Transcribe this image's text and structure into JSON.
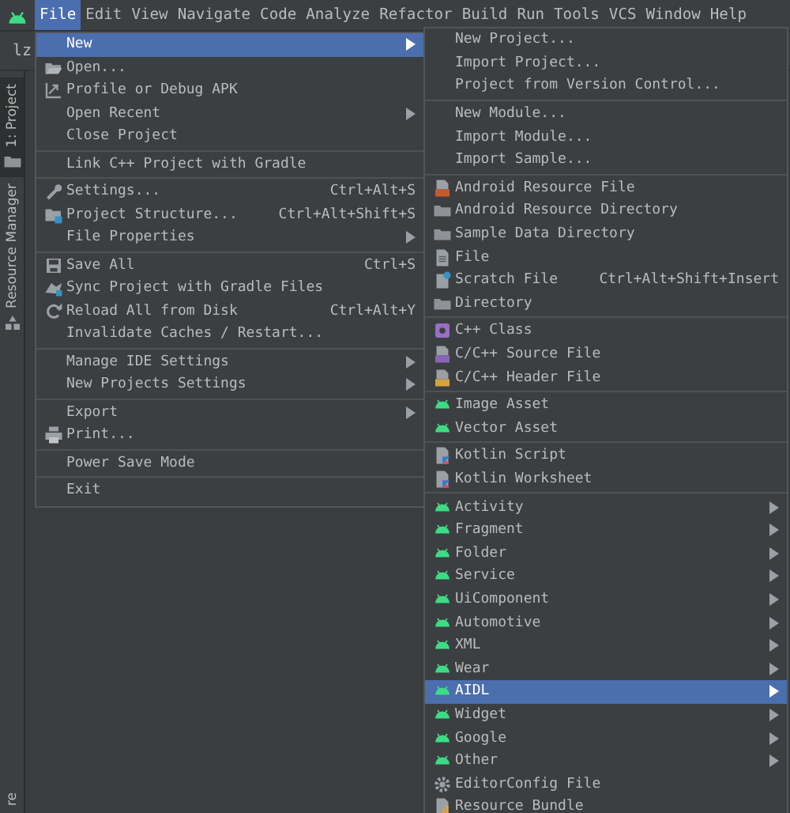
{
  "menu_bar": [
    {
      "label": "File",
      "selected": true
    },
    {
      "label": "Edit",
      "selected": false
    },
    {
      "label": "View",
      "selected": false
    },
    {
      "label": "Navigate",
      "selected": false
    },
    {
      "label": "Code",
      "selected": false
    },
    {
      "label": "Analyze",
      "selected": false
    },
    {
      "label": "Refactor",
      "selected": false
    },
    {
      "label": "Build",
      "selected": false
    },
    {
      "label": "Run",
      "selected": false
    },
    {
      "label": "Tools",
      "selected": false
    },
    {
      "label": "VCS",
      "selected": false
    },
    {
      "label": "Window",
      "selected": false
    },
    {
      "label": "Help",
      "selected": false
    }
  ],
  "toolbar": {
    "project_name": "lz"
  },
  "side_tabs": [
    {
      "label": "1: Project",
      "selected": true,
      "kind": "folder"
    },
    {
      "label": "Resource Manager",
      "selected": false,
      "kind": "resource"
    }
  ],
  "side_tab_bottom": "re",
  "file_menu": [
    [
      {
        "label": "New",
        "selected": true,
        "submenu": true,
        "kind": "none"
      },
      {
        "label": "Open...",
        "selected": false,
        "kind": "open"
      },
      {
        "label": "Profile or Debug APK",
        "selected": false,
        "kind": "profile"
      },
      {
        "label": "Open Recent",
        "selected": false,
        "submenu": true,
        "kind": "none"
      },
      {
        "label": "Close Project",
        "selected": false,
        "kind": "none"
      }
    ],
    [
      {
        "label": "Link C++ Project with Gradle",
        "selected": false,
        "kind": "none"
      }
    ],
    [
      {
        "label": "Settings...",
        "selected": false,
        "shortcut": "Ctrl+Alt+S",
        "kind": "wrench"
      },
      {
        "label": "Project Structure...",
        "selected": false,
        "shortcut": "Ctrl+Alt+Shift+S",
        "kind": "structure"
      },
      {
        "label": "File Properties",
        "selected": false,
        "submenu": true,
        "kind": "none"
      }
    ],
    [
      {
        "label": "Save All",
        "selected": false,
        "shortcut": "Ctrl+S",
        "kind": "save"
      },
      {
        "label": "Sync Project with Gradle Files",
        "selected": false,
        "kind": "sync"
      },
      {
        "label": "Reload All from Disk",
        "selected": false,
        "shortcut": "Ctrl+Alt+Y",
        "kind": "reload"
      },
      {
        "label": "Invalidate Caches / Restart...",
        "selected": false,
        "kind": "none"
      }
    ],
    [
      {
        "label": "Manage IDE Settings",
        "selected": false,
        "submenu": true,
        "kind": "none"
      },
      {
        "label": "New Projects Settings",
        "selected": false,
        "submenu": true,
        "kind": "none"
      }
    ],
    [
      {
        "label": "Export",
        "selected": false,
        "submenu": true,
        "kind": "none"
      },
      {
        "label": "Print...",
        "selected": false,
        "kind": "print"
      }
    ],
    [
      {
        "label": "Power Save Mode",
        "selected": false,
        "kind": "none"
      }
    ],
    [
      {
        "label": "Exit",
        "selected": false,
        "kind": "none"
      }
    ]
  ],
  "new_menu": [
    [
      {
        "label": "New Project...",
        "selected": false,
        "kind": "none"
      },
      {
        "label": "Import Project...",
        "selected": false,
        "kind": "none"
      },
      {
        "label": "Project from Version Control...",
        "selected": false,
        "kind": "none"
      }
    ],
    [
      {
        "label": "New Module...",
        "selected": false,
        "kind": "none"
      },
      {
        "label": "Import Module...",
        "selected": false,
        "kind": "none"
      },
      {
        "label": "Import Sample...",
        "selected": false,
        "kind": "none"
      }
    ],
    [
      {
        "label": "Android Resource File",
        "selected": false,
        "kind": "resfile"
      },
      {
        "label": "Android Resource Directory",
        "selected": false,
        "kind": "folder"
      },
      {
        "label": "Sample Data Directory",
        "selected": false,
        "kind": "folder"
      },
      {
        "label": "File",
        "selected": false,
        "kind": "file"
      },
      {
        "label": "Scratch File",
        "selected": false,
        "shortcut": "Ctrl+Alt+Shift+Insert",
        "kind": "scratch"
      },
      {
        "label": "Directory",
        "selected": false,
        "kind": "folder"
      }
    ],
    [
      {
        "label": "C++ Class",
        "selected": false,
        "kind": "cppclass"
      },
      {
        "label": "C/C++ Source File",
        "selected": false,
        "kind": "cppsource"
      },
      {
        "label": "C/C++ Header File",
        "selected": false,
        "kind": "cppheader"
      }
    ],
    [
      {
        "label": "Image Asset",
        "selected": false,
        "kind": "android"
      },
      {
        "label": "Vector Asset",
        "selected": false,
        "kind": "android"
      }
    ],
    [
      {
        "label": "Kotlin Script",
        "selected": false,
        "kind": "kotlin"
      },
      {
        "label": "Kotlin Worksheet",
        "selected": false,
        "kind": "kotlin"
      }
    ],
    [
      {
        "label": "Activity",
        "selected": false,
        "submenu": true,
        "kind": "android"
      },
      {
        "label": "Fragment",
        "selected": false,
        "submenu": true,
        "kind": "android"
      },
      {
        "label": "Folder",
        "selected": false,
        "submenu": true,
        "kind": "android"
      },
      {
        "label": "Service",
        "selected": false,
        "submenu": true,
        "kind": "android"
      },
      {
        "label": "UiComponent",
        "selected": false,
        "submenu": true,
        "kind": "android"
      },
      {
        "label": "Automotive",
        "selected": false,
        "submenu": true,
        "kind": "android"
      },
      {
        "label": "XML",
        "selected": false,
        "submenu": true,
        "kind": "android"
      },
      {
        "label": "Wear",
        "selected": false,
        "submenu": true,
        "kind": "android"
      },
      {
        "label": "AIDL",
        "selected": true,
        "submenu": true,
        "kind": "android"
      },
      {
        "label": "Widget",
        "selected": false,
        "submenu": true,
        "kind": "android"
      },
      {
        "label": "Google",
        "selected": false,
        "submenu": true,
        "kind": "android"
      },
      {
        "label": "Other",
        "selected": false,
        "submenu": true,
        "kind": "android"
      },
      {
        "label": "EditorConfig File",
        "selected": false,
        "kind": "gear"
      },
      {
        "label": "Resource Bundle",
        "selected": false,
        "kind": "bundle"
      }
    ]
  ]
}
